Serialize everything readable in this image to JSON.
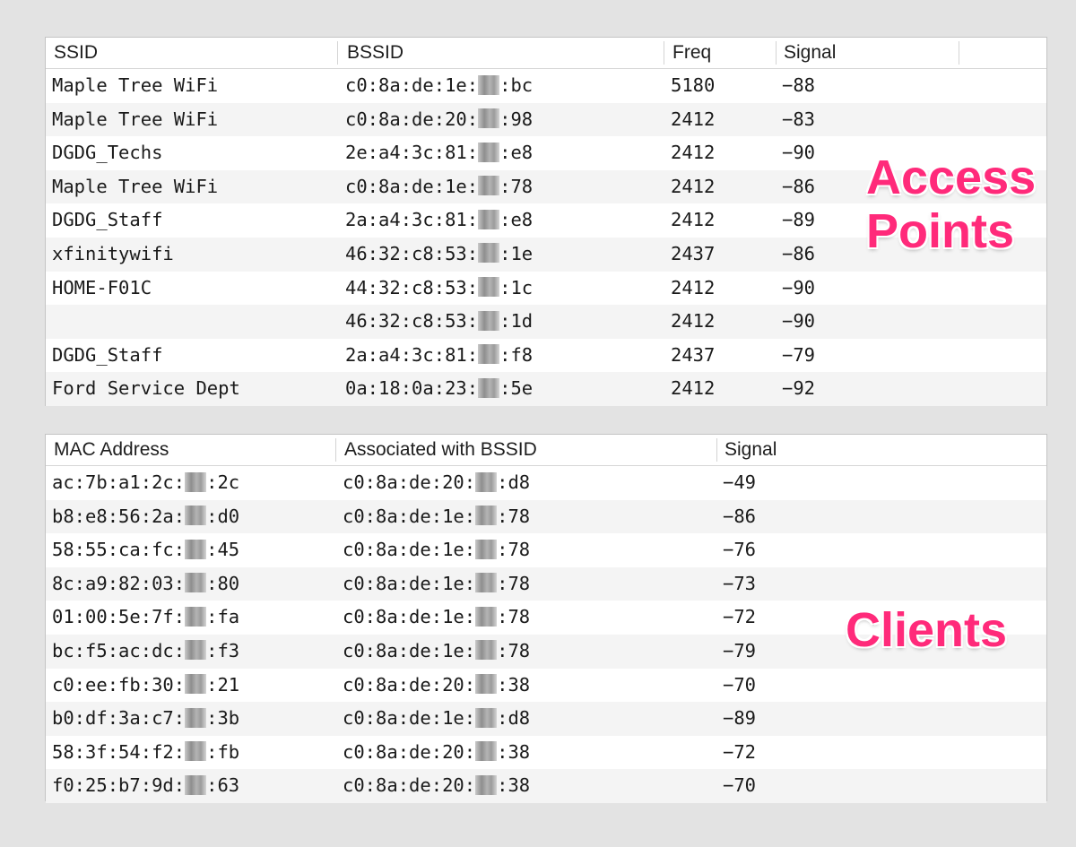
{
  "access_points": {
    "columns": [
      "SSID",
      "BSSID",
      "Freq",
      "Signal"
    ],
    "rows": [
      {
        "ssid": "Maple Tree WiFi",
        "bssid_prefix": "c0:8a:de:1e:",
        "bssid_suffix": ":bc",
        "freq": "5180",
        "signal": "−88"
      },
      {
        "ssid": "Maple Tree WiFi",
        "bssid_prefix": "c0:8a:de:20:",
        "bssid_suffix": ":98",
        "freq": "2412",
        "signal": "−83"
      },
      {
        "ssid": "DGDG_Techs",
        "bssid_prefix": "2e:a4:3c:81:",
        "bssid_suffix": ":e8",
        "freq": "2412",
        "signal": "−90"
      },
      {
        "ssid": "Maple Tree WiFi",
        "bssid_prefix": "c0:8a:de:1e:",
        "bssid_suffix": ":78",
        "freq": "2412",
        "signal": "−86"
      },
      {
        "ssid": "DGDG_Staff",
        "bssid_prefix": "2a:a4:3c:81:",
        "bssid_suffix": ":e8",
        "freq": "2412",
        "signal": "−89"
      },
      {
        "ssid": "xfinitywifi",
        "bssid_prefix": "46:32:c8:53:",
        "bssid_suffix": ":1e",
        "freq": "2437",
        "signal": "−86"
      },
      {
        "ssid": "HOME-F01C",
        "bssid_prefix": "44:32:c8:53:",
        "bssid_suffix": ":1c",
        "freq": "2412",
        "signal": "−90"
      },
      {
        "ssid": "",
        "bssid_prefix": "46:32:c8:53:",
        "bssid_suffix": ":1d",
        "freq": "2412",
        "signal": "−90"
      },
      {
        "ssid": "DGDG_Staff",
        "bssid_prefix": "2a:a4:3c:81:",
        "bssid_suffix": ":f8",
        "freq": "2437",
        "signal": "−79"
      },
      {
        "ssid": "Ford Service Dept",
        "bssid_prefix": "0a:18:0a:23:",
        "bssid_suffix": ":5e",
        "freq": "2412",
        "signal": "−92"
      }
    ]
  },
  "clients": {
    "columns": [
      "MAC Address",
      "Associated with BSSID",
      "Signal"
    ],
    "rows": [
      {
        "mac_prefix": "ac:7b:a1:2c:",
        "mac_suffix": ":2c",
        "assoc_prefix": "c0:8a:de:20:",
        "assoc_suffix": ":d8",
        "signal": "−49"
      },
      {
        "mac_prefix": "b8:e8:56:2a:",
        "mac_suffix": ":d0",
        "assoc_prefix": "c0:8a:de:1e:",
        "assoc_suffix": ":78",
        "signal": "−86"
      },
      {
        "mac_prefix": "58:55:ca:fc:",
        "mac_suffix": ":45",
        "assoc_prefix": "c0:8a:de:1e:",
        "assoc_suffix": ":78",
        "signal": "−76"
      },
      {
        "mac_prefix": "8c:a9:82:03:",
        "mac_suffix": ":80",
        "assoc_prefix": "c0:8a:de:1e:",
        "assoc_suffix": ":78",
        "signal": "−73"
      },
      {
        "mac_prefix": "01:00:5e:7f:",
        "mac_suffix": ":fa",
        "assoc_prefix": "c0:8a:de:1e:",
        "assoc_suffix": ":78",
        "signal": "−72"
      },
      {
        "mac_prefix": "bc:f5:ac:dc:",
        "mac_suffix": ":f3",
        "assoc_prefix": "c0:8a:de:1e:",
        "assoc_suffix": ":78",
        "signal": "−79"
      },
      {
        "mac_prefix": "c0:ee:fb:30:",
        "mac_suffix": ":21",
        "assoc_prefix": "c0:8a:de:20:",
        "assoc_suffix": ":38",
        "signal": "−70"
      },
      {
        "mac_prefix": "b0:df:3a:c7:",
        "mac_suffix": ":3b",
        "assoc_prefix": "c0:8a:de:1e:",
        "assoc_suffix": ":d8",
        "signal": "−89"
      },
      {
        "mac_prefix": "58:3f:54:f2:",
        "mac_suffix": ":fb",
        "assoc_prefix": "c0:8a:de:20:",
        "assoc_suffix": ":38",
        "signal": "−72"
      },
      {
        "mac_prefix": "f0:25:b7:9d:",
        "mac_suffix": ":63",
        "assoc_prefix": "c0:8a:de:20:",
        "assoc_suffix": ":38",
        "signal": "−70"
      }
    ]
  },
  "annotations": {
    "access_points_line1": "Access",
    "access_points_line2": "Points",
    "clients": "Clients",
    "color": "#ff2a7a"
  }
}
